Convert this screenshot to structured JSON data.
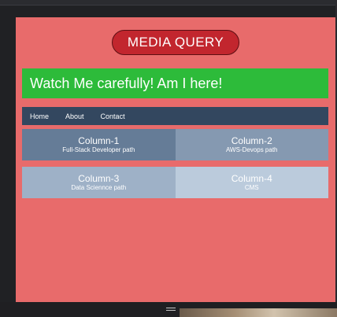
{
  "page": {
    "title": "MEDIA QUERY",
    "banner": "Watch Me carefully! Am I here!"
  },
  "nav": {
    "items": [
      {
        "label": "Home"
      },
      {
        "label": "About"
      },
      {
        "label": "Contact"
      }
    ]
  },
  "columns": [
    {
      "title": "Column-1",
      "subtitle": "Full-Stack Developer path",
      "color": "#657c97"
    },
    {
      "title": "Column-2",
      "subtitle": "AWS-Devops path",
      "color": "#8599b1"
    },
    {
      "title": "Column-3",
      "subtitle": "Data Sciennce path",
      "color": "#9eb1c7"
    },
    {
      "title": "Column-4",
      "subtitle": "CMS",
      "color": "#bbcbdc"
    }
  ],
  "colors": {
    "page_background": "#e86b6b",
    "title_pill": "#c2262e",
    "banner": "#2dbb3a",
    "navbar": "#33475f"
  },
  "icons": {
    "resize_handle": "drag-handle-icon"
  }
}
